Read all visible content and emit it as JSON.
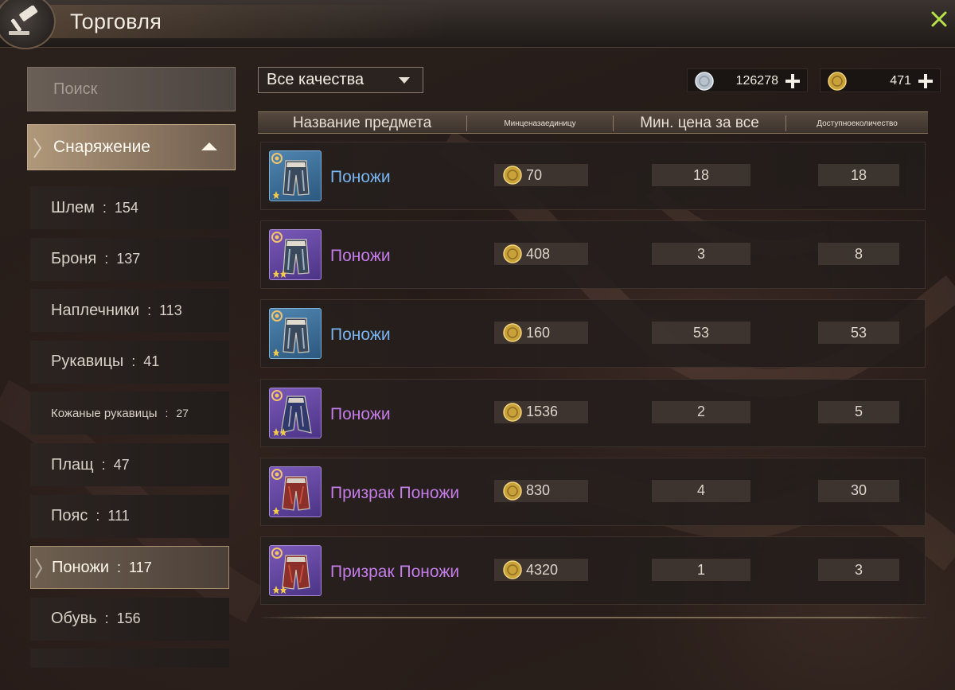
{
  "window": {
    "title": "Торговля"
  },
  "search": {
    "placeholder": "Поиск"
  },
  "category": {
    "label": "Снаряжение"
  },
  "subcategories": [
    {
      "label": "Шлем",
      "count": "154",
      "small": false,
      "active": false
    },
    {
      "label": "Броня",
      "count": "137",
      "small": false,
      "active": false
    },
    {
      "label": "Наплечники",
      "count": "113",
      "small": false,
      "active": false
    },
    {
      "label": "Рукавицы",
      "count": "41",
      "small": false,
      "active": false
    },
    {
      "label": "Кожаные рукавицы",
      "count": "27",
      "small": true,
      "active": false
    },
    {
      "label": "Плащ",
      "count": "47",
      "small": false,
      "active": false
    },
    {
      "label": "Пояс",
      "count": "111",
      "small": false,
      "active": false
    },
    {
      "label": "Поножи",
      "count": "117",
      "small": false,
      "active": true
    },
    {
      "label": "Обувь",
      "count": "156",
      "small": false,
      "active": false
    }
  ],
  "quality_filter": {
    "selected": "Все качества"
  },
  "currencies": [
    {
      "name": "silver",
      "icon": "silver-coin-icon",
      "amount": "126278"
    },
    {
      "name": "gold",
      "icon": "gold-coin-icon",
      "amount": "471"
    }
  ],
  "table": {
    "columns": [
      "Название предмета",
      "Минценазаединицу",
      "Мин. цена за все",
      "Доступноеколичество"
    ],
    "rows": [
      {
        "name": "Поножи",
        "rarity": "blue",
        "stars": 1,
        "variant": "pants",
        "unit_price": "70",
        "total_price": "18",
        "quantity": "18"
      },
      {
        "name": "Поножи",
        "rarity": "purple",
        "stars": 2,
        "variant": "pants",
        "unit_price": "408",
        "total_price": "3",
        "quantity": "8"
      },
      {
        "name": "Поножи",
        "rarity": "blue",
        "stars": 1,
        "variant": "pants",
        "unit_price": "160",
        "total_price": "53",
        "quantity": "53"
      },
      {
        "name": "Поножи",
        "rarity": "purple",
        "stars": 2,
        "variant": "robe",
        "unit_price": "1536",
        "total_price": "2",
        "quantity": "5"
      },
      {
        "name": "Призрак Поножи",
        "rarity": "purple",
        "stars": 1,
        "variant": "ghost",
        "unit_price": "830",
        "total_price": "4",
        "quantity": "30"
      },
      {
        "name": "Призрак Поножи",
        "rarity": "purple",
        "stars": 2,
        "variant": "ghost",
        "unit_price": "4320",
        "total_price": "1",
        "quantity": "3"
      }
    ]
  },
  "colors": {
    "rarity_blue": "#79b5f0",
    "rarity_purple": "#c47de8",
    "accent_gold": "#b0987a",
    "close_green": "#b6e24a"
  }
}
